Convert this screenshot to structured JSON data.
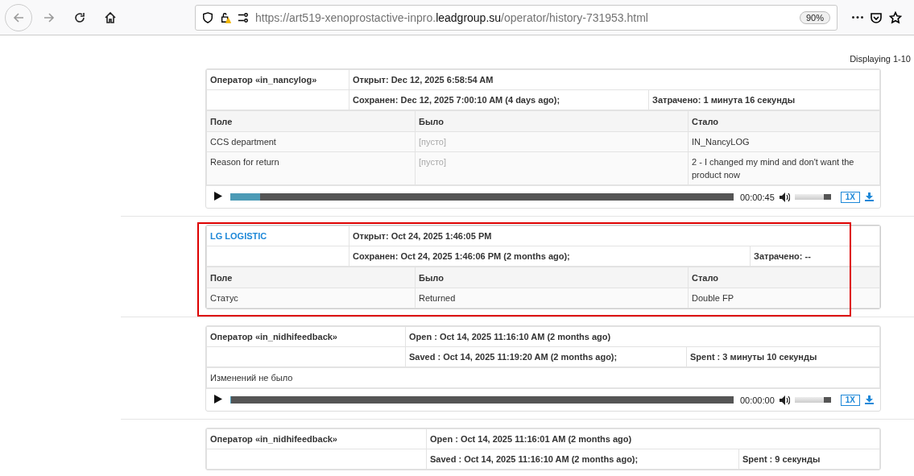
{
  "browser": {
    "url_prefix": "https://art519-xenoprostactive-inpro.",
    "url_domain": "leadgroup.su",
    "url_path": "/operator/history-731953.html",
    "zoom": "90%"
  },
  "pagination": "Displaying 1-10",
  "entries": [
    {
      "kind": "operator",
      "operator": "Оператор «in_nancylog»",
      "opened": "Открыт: Dec 12, 2025 6:58:54 AM",
      "saved": "Сохранен: Dec 12, 2025 7:00:10 AM (4 days ago);",
      "spent": "Затрачено: 1 минута 16 секунды",
      "highlighted": false,
      "columns": [
        "Поле",
        "Было",
        "Стало"
      ],
      "rows": [
        {
          "field": "CCS department",
          "before": "[пусто]",
          "before_empty": true,
          "after": "IN_NancyLOG"
        },
        {
          "field": "Reason for return",
          "before": "[пусто]",
          "before_empty": true,
          "after": "2 - I changed my mind and don't want the product now"
        }
      ],
      "player": {
        "level": 0.06,
        "time": "00:00:45",
        "volume": {
          "level": 0.8
        },
        "speed": "1X"
      }
    },
    {
      "kind": "link",
      "operator": "LG LOGISTIC",
      "opened": "Открыт: Oct 24, 2025 1:46:05 PM",
      "saved": "Сохранен: Oct 24, 2025 1:46:06 PM (2 months ago);",
      "spent": "Затрачено: --",
      "highlighted": true,
      "columns": [
        "Поле",
        "Было",
        "Стало"
      ],
      "rows": [
        {
          "field": "Статус",
          "before": "Returned",
          "before_empty": false,
          "after": "Double FP"
        }
      ]
    },
    {
      "kind": "operator",
      "operator": "Оператор «in_nidhifeedback»",
      "opened": "Open : Oct 14, 2025 11:16:10 AM (2 months ago)",
      "saved": "Saved : Oct 14, 2025 11:19:20 AM (2 months ago);",
      "spent": "Spent : 3 минуты 10 секунды",
      "highlighted": false,
      "no_changes": "Изменений не было",
      "player": {
        "level": 0,
        "time": "00:00:00",
        "volume": {
          "level": 0.8
        },
        "speed": "1X"
      }
    },
    {
      "kind": "operator",
      "operator": "Оператор «in_nidhifeedback»",
      "opened": "Open : Oct 14, 2025 11:16:01 AM (2 months ago)",
      "saved": "Saved : Oct 14, 2025 11:16:10 AM (2 months ago);",
      "spent": "Spent : 9 секунды",
      "highlighted": false
    }
  ]
}
